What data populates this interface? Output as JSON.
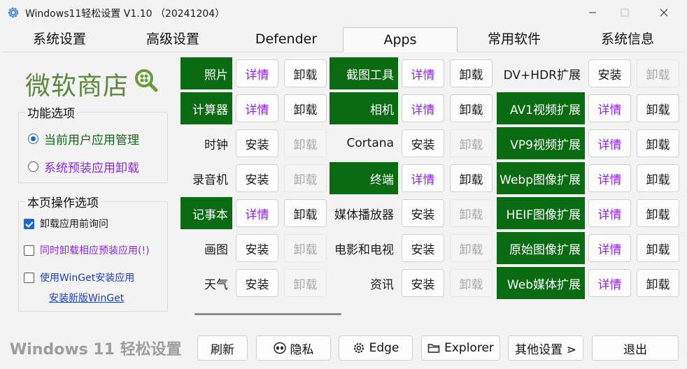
{
  "window": {
    "title": "Windows11轻松设置 V1.10 （20241204）",
    "controls": [
      "minimize",
      "maximize",
      "close"
    ]
  },
  "tabs": [
    {
      "label": "系统设置"
    },
    {
      "label": "高级设置"
    },
    {
      "label": "Defender"
    },
    {
      "label": "Apps",
      "active": true
    },
    {
      "label": "常用软件"
    },
    {
      "label": "系统信息"
    }
  ],
  "sidebar": {
    "store_title": "微软商店",
    "function_group": {
      "label": "功能选项",
      "options": [
        {
          "label": "当前用户应用管理",
          "selected": true
        },
        {
          "label": "系统预装应用卸载",
          "selected": false
        }
      ]
    },
    "page_group": {
      "label": "本页操作选项",
      "checks": [
        {
          "label": "卸载应用前询问",
          "checked": true
        },
        {
          "label": "同时卸载相应预装应用(!)",
          "checked": false
        },
        {
          "label": "使用WinGet安装应用",
          "checked": false
        }
      ],
      "link": "安装新版WinGet"
    }
  },
  "apps": {
    "columns": [
      [
        {
          "name": "照片",
          "installed": true,
          "action": "详情",
          "remove": "卸载"
        },
        {
          "name": "计算器",
          "installed": true,
          "action": "详情",
          "remove": "卸载"
        },
        {
          "name": "时钟",
          "installed": false,
          "action": "安装",
          "remove": "卸载"
        },
        {
          "name": "录音机",
          "installed": false,
          "action": "安装",
          "remove": "卸载"
        },
        {
          "name": "记事本",
          "installed": true,
          "action": "详情",
          "remove": "卸载"
        },
        {
          "name": "画图",
          "installed": false,
          "action": "安装",
          "remove": "卸载"
        },
        {
          "name": "天气",
          "installed": false,
          "action": "安装",
          "remove": "卸载"
        }
      ],
      [
        {
          "name": "截图工具",
          "installed": true,
          "action": "详情",
          "remove": "卸载"
        },
        {
          "name": "相机",
          "installed": true,
          "action": "详情",
          "remove": "卸载"
        },
        {
          "name": "Cortana",
          "installed": false,
          "action": "安装",
          "remove": "卸载"
        },
        {
          "name": "终端",
          "installed": true,
          "action": "详情",
          "remove": "卸载"
        },
        {
          "name": "媒体播放器",
          "installed": false,
          "action": "安装",
          "remove": "卸载"
        },
        {
          "name": "电影和电视",
          "installed": false,
          "action": "安装",
          "remove": "卸载"
        },
        {
          "name": "资讯",
          "installed": false,
          "action": "安装",
          "remove": "卸载"
        }
      ],
      [
        {
          "name": "DV+HDR扩展",
          "installed": false,
          "action": "安装",
          "remove": "卸载"
        },
        {
          "name": "AV1视频扩展",
          "installed": true,
          "action": "详情",
          "remove": "卸载"
        },
        {
          "name": "VP9视频扩展",
          "installed": true,
          "action": "详情",
          "remove": "卸载"
        },
        {
          "name": "Webp图像扩展",
          "installed": true,
          "action": "详情",
          "remove": "卸载"
        },
        {
          "name": "HEIF图像扩展",
          "installed": true,
          "action": "详情",
          "remove": "卸载"
        },
        {
          "name": "原始图像扩展",
          "installed": true,
          "action": "详情",
          "remove": "卸载"
        },
        {
          "name": "Web媒体扩展",
          "installed": true,
          "action": "详情",
          "remove": "卸载"
        }
      ]
    ]
  },
  "footer": {
    "brand": "Windows 11 轻松设置",
    "buttons": [
      {
        "label": "刷新",
        "icon": ""
      },
      {
        "label": "隐私",
        "icon": "alien-face-icon"
      },
      {
        "label": "Edge",
        "icon": "gear-icon"
      },
      {
        "label": "Explorer",
        "icon": "folder-icon"
      },
      {
        "label": "其他设置 ⋗",
        "icon": ""
      },
      {
        "label": "退出",
        "icon": ""
      }
    ]
  },
  "colors": {
    "installed_bg": "#0a6b12",
    "store_title": "#5b8a3a",
    "detail_text": "#8a2bd8",
    "accent": "#1b6ac9",
    "link": "#1b3fb0"
  }
}
